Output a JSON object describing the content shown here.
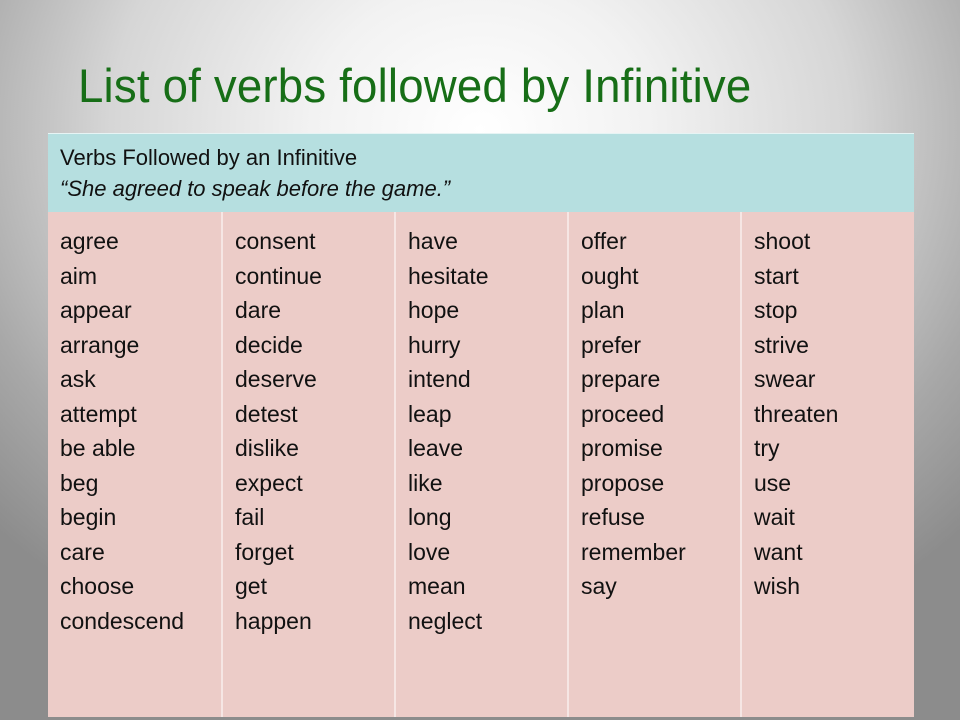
{
  "slide": {
    "title": "List of verbs followed by Infinitive"
  },
  "table": {
    "header_title": "Verbs Followed by an Infinitive",
    "header_example": "“She agreed to speak before the game.”",
    "columns": [
      {
        "verbs": [
          "agree",
          "aim",
          "appear",
          "arrange",
          "ask",
          "attempt",
          "be able",
          "beg",
          "begin",
          "care",
          "choose",
          "condescend"
        ]
      },
      {
        "verbs": [
          "consent",
          "continue",
          "dare",
          "decide",
          "deserve",
          "detest",
          "dislike",
          "expect",
          "fail",
          "forget",
          "get",
          "happen"
        ]
      },
      {
        "verbs": [
          "have",
          "hesitate",
          "hope",
          "hurry",
          "intend",
          "leap",
          "leave",
          "like",
          "long",
          "love",
          "mean",
          "neglect"
        ]
      },
      {
        "verbs": [
          "offer",
          "ought",
          "plan",
          "prefer",
          "prepare",
          "proceed",
          "promise",
          "propose",
          "refuse",
          "remember",
          "say"
        ]
      },
      {
        "verbs": [
          "shoot",
          "start",
          "stop",
          "strive",
          "swear",
          "threaten",
          "try",
          "use",
          "wait",
          "want",
          "wish"
        ]
      }
    ]
  },
  "colors": {
    "title": "#176e17",
    "header_bg": "#b6dfe0",
    "body_bg": "#ecccc8"
  }
}
